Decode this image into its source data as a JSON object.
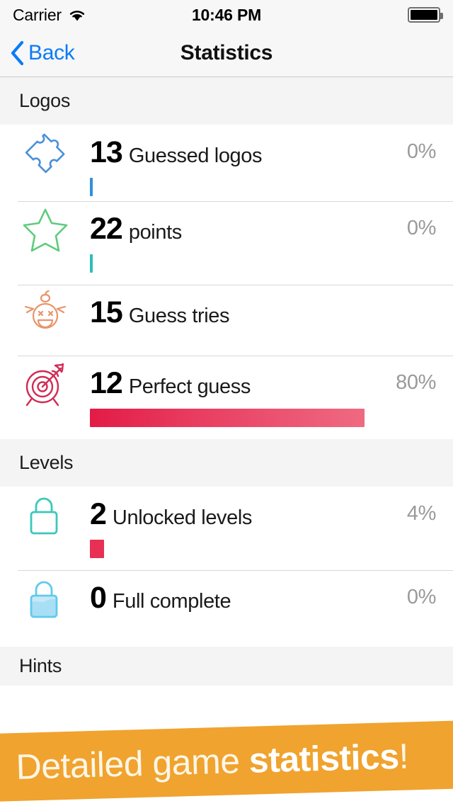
{
  "status_bar": {
    "carrier": "Carrier",
    "wifi_icon": "wifi-icon",
    "time": "10:46 PM",
    "battery_icon": "battery-full-icon"
  },
  "nav_bar": {
    "back_label": "Back",
    "back_icon": "chevron-left-icon",
    "title": "Statistics"
  },
  "colors": {
    "accent_blue": "#0a7cf7",
    "puzzle_blue": "#4a90d9",
    "star_green": "#5ecb7b",
    "face_orange": "#e8936a",
    "target_crimson": "#d22b55",
    "lock_teal": "#3bc8bb",
    "lock_blue": "#62c9ef",
    "bar_red_start": "#e31b46",
    "bar_red_end": "#ef6a81",
    "banner_orange": "#F0A32E",
    "section_bg": "#f4f4f4"
  },
  "sections": [
    {
      "title": "Logos",
      "rows": [
        {
          "icon": "puzzle-piece-icon",
          "value": "13",
          "label": "Guessed logos",
          "percent": "0%",
          "bar_percent": 1,
          "bar_color": "#2f8fe0",
          "has_bar": true
        },
        {
          "icon": "star-outline-icon",
          "value": "22",
          "label": "points",
          "percent": "0%",
          "bar_percent": 1,
          "bar_color": "#2bbfb5",
          "has_bar": true
        },
        {
          "icon": "apple-head-face-icon",
          "value": "15",
          "label": "Guess tries",
          "percent": "",
          "bar_percent": 0,
          "bar_color": "",
          "has_bar": false
        },
        {
          "icon": "target-bullseye-icon",
          "value": "12",
          "label": "Perfect guess",
          "percent": "80%",
          "bar_percent": 80,
          "bar_color": "gradient-red",
          "has_bar": true
        }
      ]
    },
    {
      "title": "Levels",
      "rows": [
        {
          "icon": "lock-open-icon",
          "value": "2",
          "label": "Unlocked levels",
          "percent": "4%",
          "bar_percent": 5,
          "bar_color": "#e82f54",
          "has_bar": true
        },
        {
          "icon": "lock-closed-icon",
          "value": "0",
          "label": "Full complete",
          "percent": "0%",
          "bar_percent": 0,
          "bar_color": "",
          "has_bar": false
        }
      ]
    },
    {
      "title": "Hints",
      "rows": []
    }
  ],
  "banner": {
    "text_regular": "Detailed game ",
    "text_bold": "statistics",
    "text_suffix": "!"
  }
}
